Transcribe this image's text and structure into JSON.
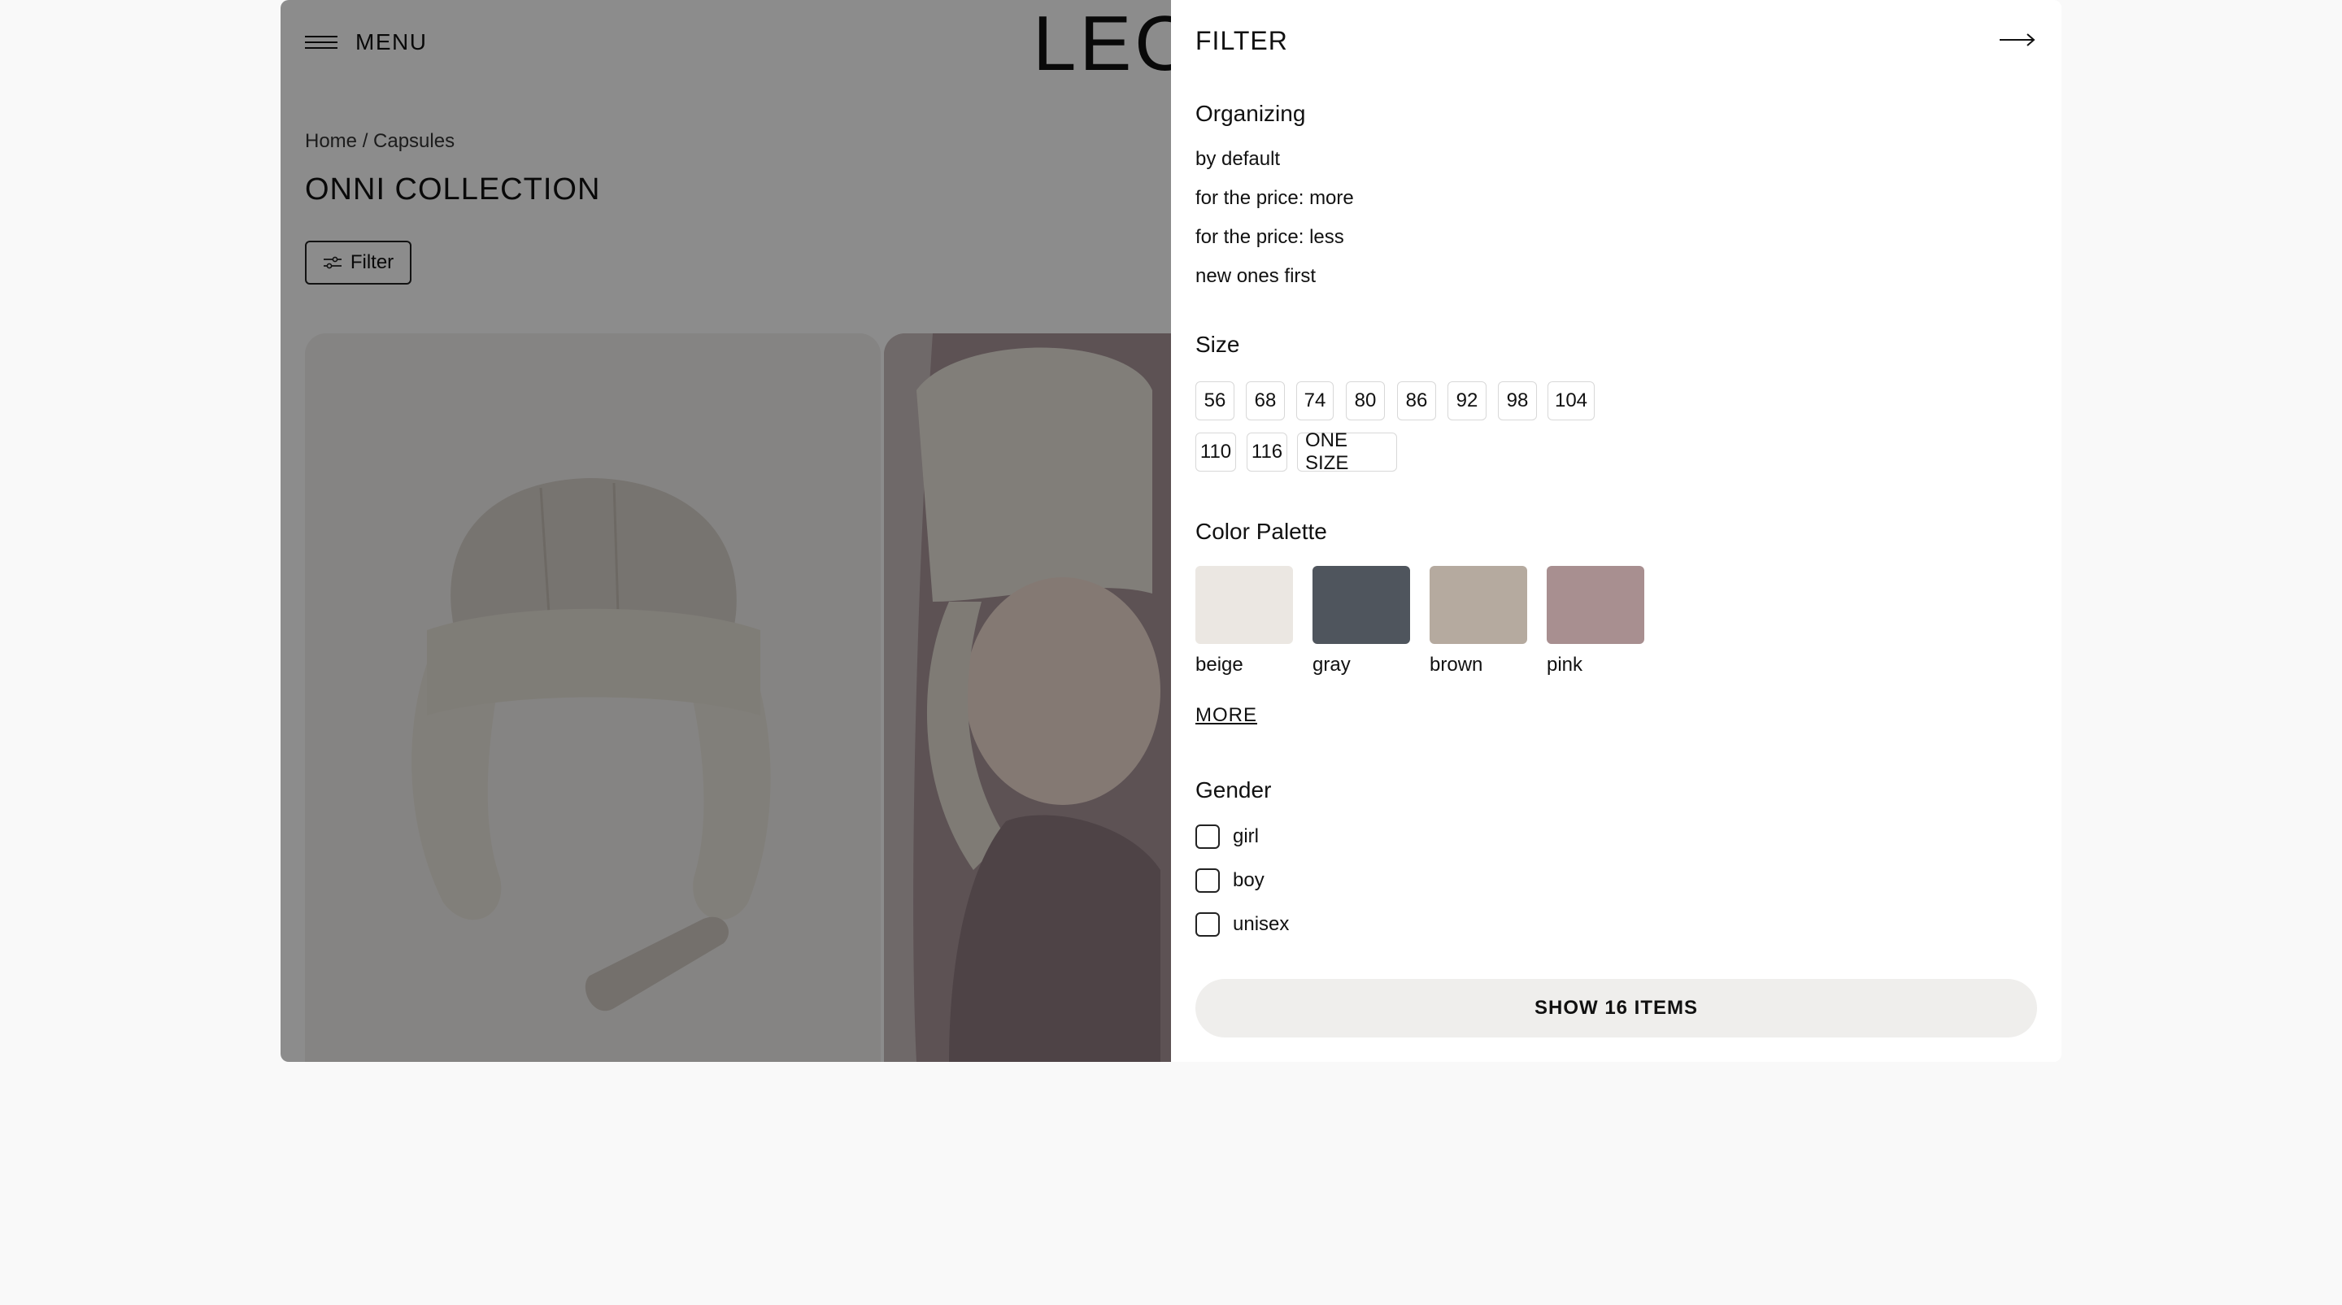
{
  "header": {
    "menu_label": "MENU",
    "logo_text": "LEO"
  },
  "breadcrumb": "Home / Capsules",
  "collection_title": "ONNI COLLECTION",
  "filter_button_label": "Filter",
  "filter_panel": {
    "title": "FILTER",
    "organizing": {
      "title": "Organizing",
      "options": [
        "by default",
        "for the price: more",
        "for the price: less",
        "new ones first"
      ]
    },
    "size": {
      "title": "Size",
      "options": [
        "56",
        "68",
        "74",
        "80",
        "86",
        "92",
        "98",
        "104",
        "110",
        "116",
        "ONE SIZE"
      ]
    },
    "color_palette": {
      "title": "Color Palette",
      "colors": [
        {
          "label": "beige",
          "hex": "#ebe7e2"
        },
        {
          "label": "gray",
          "hex": "#4f555d"
        },
        {
          "label": "brown",
          "hex": "#b5aa9f"
        },
        {
          "label": "pink",
          "hex": "#a88f90"
        }
      ],
      "more_label": "MORE"
    },
    "gender": {
      "title": "Gender",
      "options": [
        "girl",
        "boy",
        "unisex"
      ]
    },
    "show_button_label": "SHOW 16 ITEMS"
  }
}
